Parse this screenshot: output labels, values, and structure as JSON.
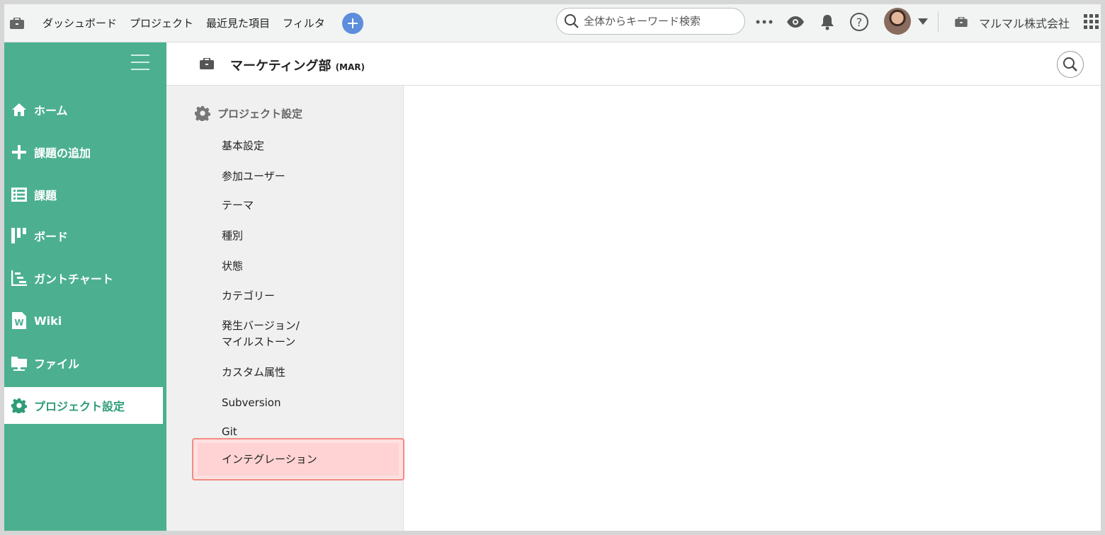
{
  "topbar": {
    "nav": [
      "ダッシュボード",
      "プロジェクト",
      "最近見た項目",
      "フィルタ"
    ],
    "search_placeholder": "全体からキーワード検索",
    "company": "マルマル株式会社"
  },
  "sidebar": {
    "items": [
      {
        "label": "ホーム",
        "icon": "home-icon"
      },
      {
        "label": "課題の追加",
        "icon": "plus-icon"
      },
      {
        "label": "課題",
        "icon": "list-icon"
      },
      {
        "label": "ボード",
        "icon": "board-icon"
      },
      {
        "label": "ガントチャート",
        "icon": "gantt-icon"
      },
      {
        "label": "Wiki",
        "icon": "wiki-icon"
      },
      {
        "label": "ファイル",
        "icon": "folder-icon"
      },
      {
        "label": "プロジェクト設定",
        "icon": "gear-icon"
      }
    ],
    "active": "プロジェクト設定"
  },
  "project": {
    "name": "マーケティング部",
    "key": "(MAR)"
  },
  "settings": {
    "heading": "プロジェクト設定",
    "items": [
      "基本設定",
      "参加ユーザー",
      "テーマ",
      "種別",
      "状態",
      "カテゴリー",
      "発生バージョン/",
      "マイルストーン",
      "カスタム属性",
      "Subversion",
      "Git",
      "インテグレーション"
    ],
    "highlighted": "インテグレーション"
  },
  "colors": {
    "sidebar": "#4cb090",
    "accent": "#5d8ddc",
    "highlight_border": "#f28b82"
  }
}
